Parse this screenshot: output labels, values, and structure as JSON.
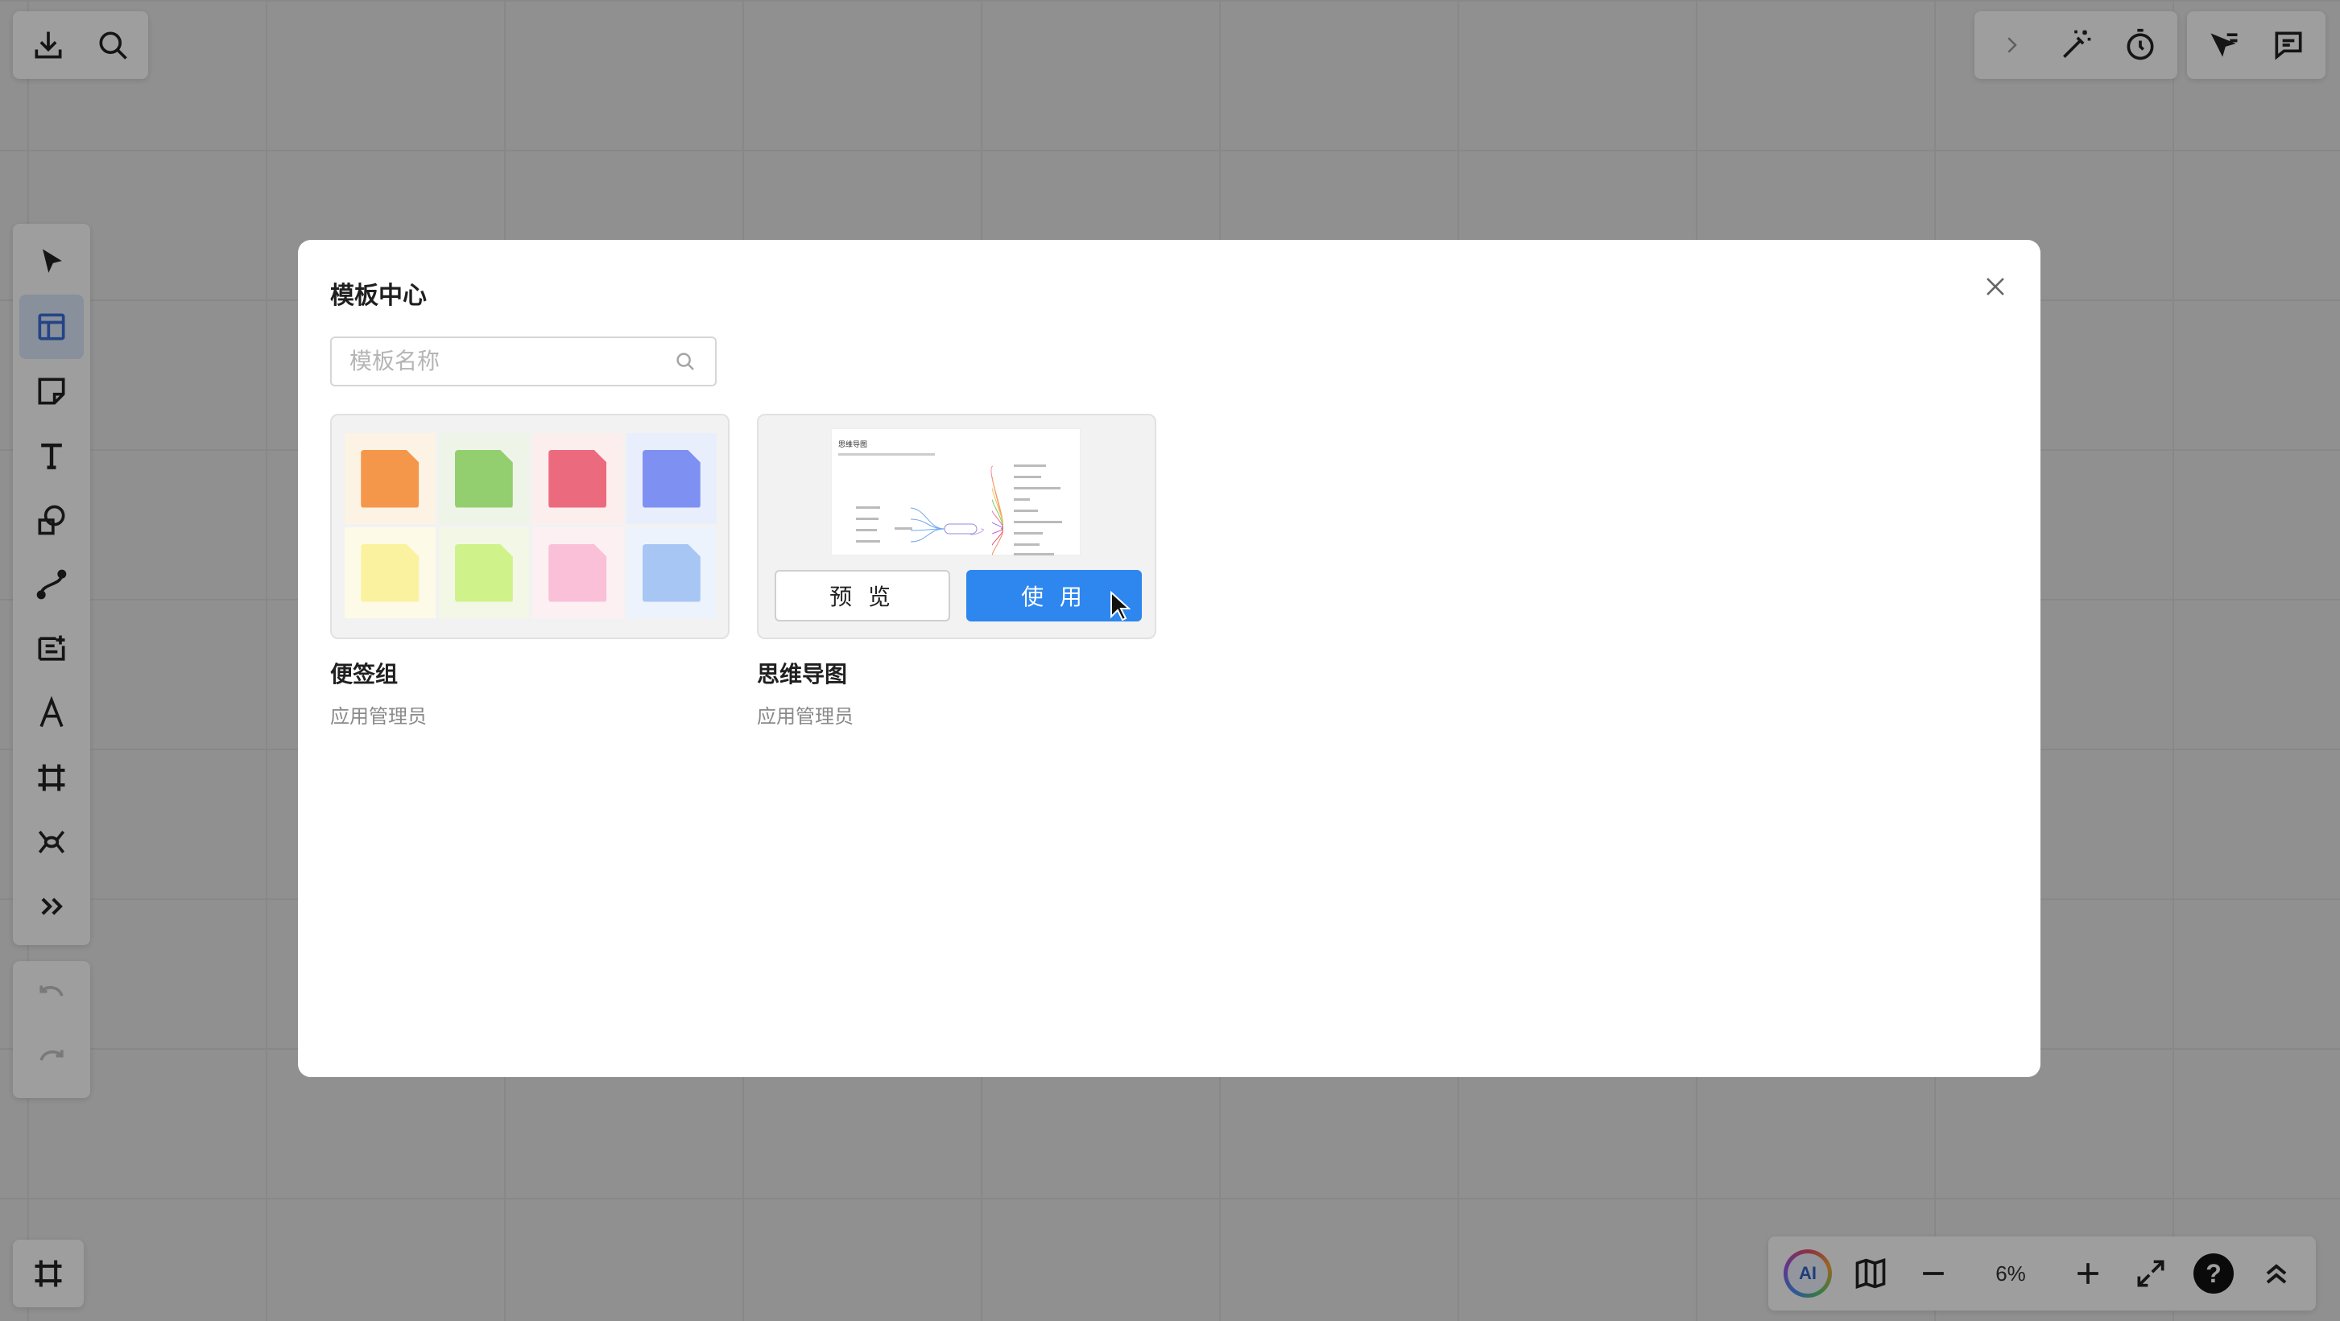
{
  "toolbar_top_left": {
    "icons": [
      "download-icon",
      "search-icon"
    ]
  },
  "toolbar_top_right": {
    "icons": [
      "chevron-right-icon",
      "magic-wand-icon",
      "timer-icon",
      "cursor-follow-icon",
      "comment-icon"
    ]
  },
  "left_toolbar": {
    "tools": [
      "select-icon",
      "template-icon",
      "sticky-note-icon",
      "text-icon",
      "shape-icon",
      "connector-icon",
      "text-card-icon",
      "pen-icon",
      "frame-icon",
      "mind-map-icon",
      "more-icon"
    ],
    "active": "template-icon",
    "history": [
      "undo-icon",
      "redo-icon"
    ]
  },
  "bottom_right": {
    "ai_label": "AI",
    "zoom": "6%",
    "help": "?"
  },
  "modal": {
    "title": "模板中心",
    "search_placeholder": "模板名称",
    "templates": [
      {
        "name": "便签组",
        "author": "应用管理员",
        "colors": [
          "#f5974a",
          "#93cf6e",
          "#ec6a7e",
          "#7e91f2",
          "#fbf29f",
          "#d0f28a",
          "#f9c0d8",
          "#a7c6f4"
        ],
        "cell_bgs": [
          "#fdf3e5",
          "#eef5e8",
          "#fdeeee",
          "#e8eefc",
          "#fdfbe7",
          "#f3f8e6",
          "#fdf0f3",
          "#edf3fc"
        ]
      },
      {
        "name": "思维导图",
        "author": "应用管理员",
        "preview_label": "预 览",
        "use_label": "使 用",
        "thumb_title": "思维导图"
      }
    ]
  }
}
